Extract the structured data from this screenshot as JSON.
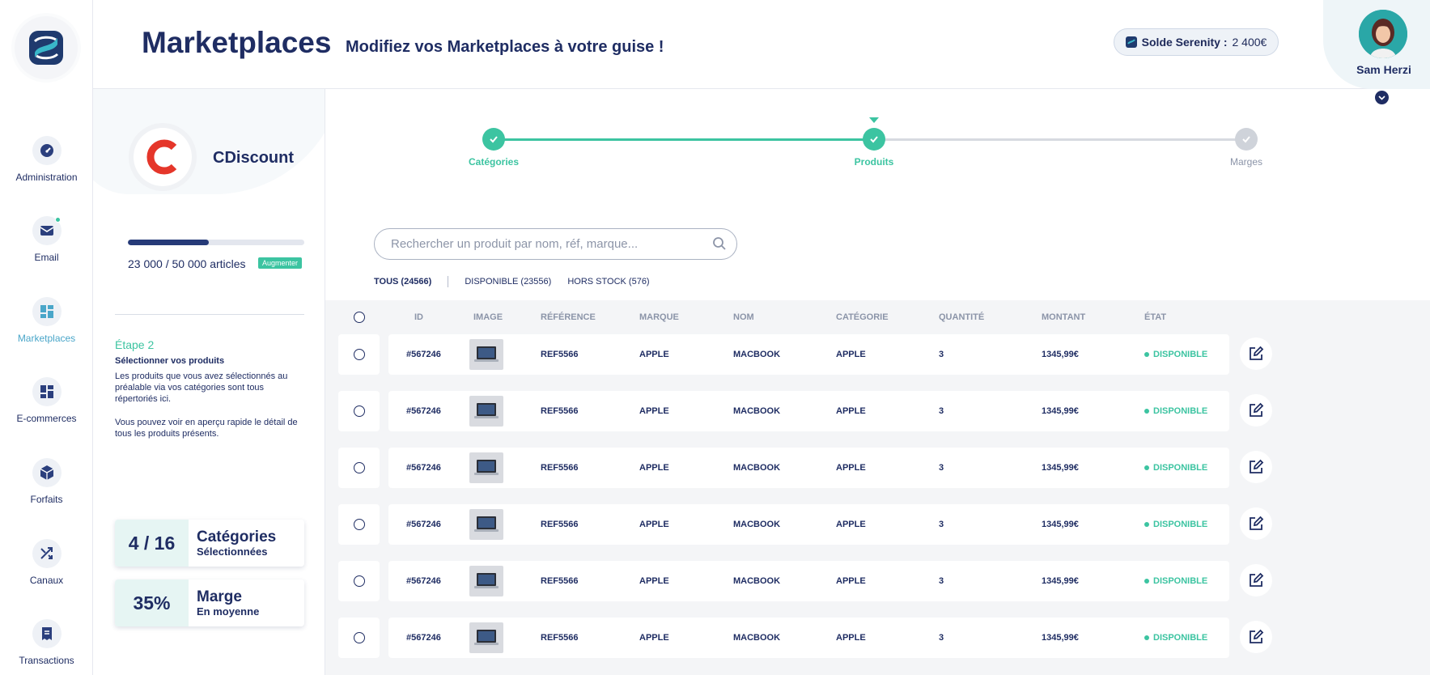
{
  "nav": {
    "items": [
      {
        "label": "Administration",
        "icon": "gauge-icon"
      },
      {
        "label": "Email",
        "icon": "mail-icon"
      },
      {
        "label": "Marketplaces",
        "icon": "marketplace-icon"
      },
      {
        "label": "E-commerces",
        "icon": "dashboard-icon"
      },
      {
        "label": "Forfaits",
        "icon": "cube-icon"
      },
      {
        "label": "Canaux",
        "icon": "shuffle-icon"
      },
      {
        "label": "Transactions",
        "icon": "receipt-icon"
      }
    ]
  },
  "header": {
    "title": "Marketplaces",
    "subtitle": "Modifiez vos Marketplaces à votre guise !",
    "balance_label": "Solde Serenity :",
    "balance_value": "2 400€",
    "user_name": "Sam Herzi"
  },
  "marketplace": {
    "name": "CDiscount",
    "progress": 0.46,
    "articles": "23 000 / 50 000 articles",
    "upgrade_label": "Augmenter",
    "step_title": "Étape 2",
    "step_subtitle": "Sélectionner vos produits",
    "step_text_1": "Les produits que vous avez sélectionnés au préalable via vos catégories sont tous répertoriés ici.",
    "step_text_2": "Vous pouvez voir en aperçu rapide le détail de tous les produits présents.",
    "stats": [
      {
        "value": "4 / 16",
        "title": "Catégories",
        "subtitle": "Sélectionnées"
      },
      {
        "value": "35%",
        "title": "Marge",
        "subtitle": "En moyenne"
      }
    ]
  },
  "stepper": {
    "steps": [
      {
        "label": "Catégories",
        "state": "done"
      },
      {
        "label": "Produits",
        "state": "current"
      },
      {
        "label": "Marges",
        "state": "pending"
      }
    ]
  },
  "search": {
    "placeholder": "Rechercher un produit par nom, réf, marque..."
  },
  "filters": [
    "TOUS (24566)",
    "DISPONIBLE (23556)",
    "HORS STOCK (576)"
  ],
  "table": {
    "columns": [
      "ID",
      "IMAGE",
      "RÉFÉRENCE",
      "MARQUE",
      "NOM",
      "CATÉGORIE",
      "QUANTITÉ",
      "MONTANT",
      "ÉTAT"
    ],
    "rows": [
      {
        "id": "#567246",
        "ref": "REF5566",
        "brand": "APPLE",
        "name": "MACBOOK",
        "category": "APPLE",
        "qty": "3",
        "amount": "1345,99€",
        "state": "DISPONIBLE"
      },
      {
        "id": "#567246",
        "ref": "REF5566",
        "brand": "APPLE",
        "name": "MACBOOK",
        "category": "APPLE",
        "qty": "3",
        "amount": "1345,99€",
        "state": "DISPONIBLE"
      },
      {
        "id": "#567246",
        "ref": "REF5566",
        "brand": "APPLE",
        "name": "MACBOOK",
        "category": "APPLE",
        "qty": "3",
        "amount": "1345,99€",
        "state": "DISPONIBLE"
      },
      {
        "id": "#567246",
        "ref": "REF5566",
        "brand": "APPLE",
        "name": "MACBOOK",
        "category": "APPLE",
        "qty": "3",
        "amount": "1345,99€",
        "state": "DISPONIBLE"
      },
      {
        "id": "#567246",
        "ref": "REF5566",
        "brand": "APPLE",
        "name": "MACBOOK",
        "category": "APPLE",
        "qty": "3",
        "amount": "1345,99€",
        "state": "DISPONIBLE"
      },
      {
        "id": "#567246",
        "ref": "REF5566",
        "brand": "APPLE",
        "name": "MACBOOK",
        "category": "APPLE",
        "qty": "3",
        "amount": "1345,99€",
        "state": "DISPONIBLE"
      }
    ]
  },
  "colors": {
    "accent": "#3cc4a1",
    "navy": "#1f2d63",
    "link": "#4aa6c9"
  }
}
